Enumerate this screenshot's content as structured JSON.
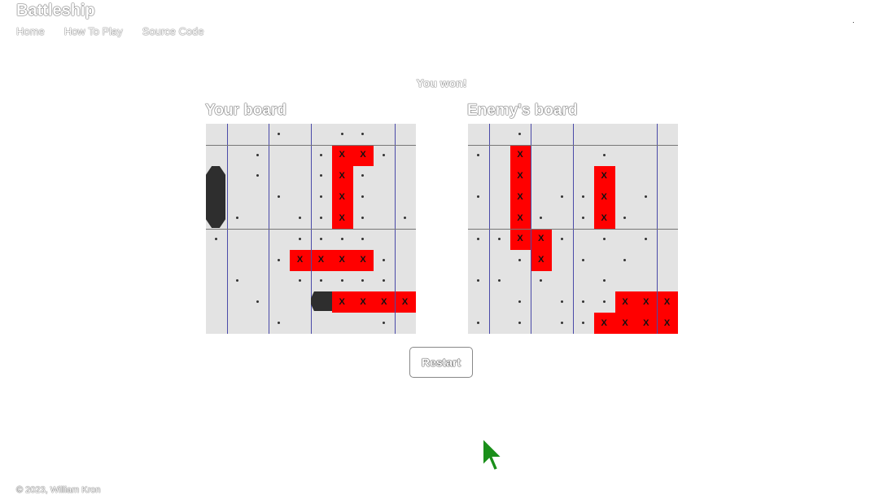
{
  "site": {
    "title": "Battleship"
  },
  "nav": {
    "items": [
      "Home",
      "How To Play",
      "Source Code"
    ]
  },
  "status": "You won!",
  "boards": {
    "player": {
      "title": "Your board",
      "hits": [
        [
          1,
          6
        ],
        [
          1,
          7
        ],
        [
          2,
          6
        ],
        [
          3,
          6
        ],
        [
          4,
          6
        ],
        [
          6,
          4
        ],
        [
          6,
          5
        ],
        [
          6,
          6
        ],
        [
          6,
          7
        ],
        [
          8,
          6
        ],
        [
          8,
          7
        ],
        [
          8,
          8
        ],
        [
          8,
          9
        ]
      ],
      "misses": [
        [
          0,
          3
        ],
        [
          0,
          6
        ],
        [
          0,
          7
        ],
        [
          1,
          2
        ],
        [
          1,
          5
        ],
        [
          1,
          8
        ],
        [
          2,
          2
        ],
        [
          2,
          5
        ],
        [
          2,
          7
        ],
        [
          3,
          3
        ],
        [
          3,
          5
        ],
        [
          3,
          7
        ],
        [
          4,
          1
        ],
        [
          4,
          4
        ],
        [
          4,
          5
        ],
        [
          4,
          7
        ],
        [
          4,
          9
        ],
        [
          5,
          0
        ],
        [
          5,
          4
        ],
        [
          5,
          5
        ],
        [
          5,
          6
        ],
        [
          5,
          7
        ],
        [
          6,
          3
        ],
        [
          6,
          8
        ],
        [
          7,
          1
        ],
        [
          7,
          4
        ],
        [
          7,
          5
        ],
        [
          7,
          6
        ],
        [
          7,
          7
        ],
        [
          7,
          8
        ],
        [
          8,
          2
        ],
        [
          9,
          3
        ],
        [
          9,
          8
        ]
      ]
    },
    "enemy": {
      "title": "Enemy's board",
      "hits": [
        [
          1,
          2
        ],
        [
          2,
          2
        ],
        [
          2,
          6
        ],
        [
          3,
          2
        ],
        [
          3,
          6
        ],
        [
          4,
          2
        ],
        [
          4,
          6
        ],
        [
          5,
          2
        ],
        [
          5,
          3
        ],
        [
          6,
          3
        ],
        [
          8,
          7
        ],
        [
          8,
          8
        ],
        [
          8,
          9
        ],
        [
          9,
          6
        ],
        [
          9,
          7
        ],
        [
          9,
          8
        ],
        [
          9,
          9
        ]
      ],
      "misses": [
        [
          0,
          2
        ],
        [
          1,
          0
        ],
        [
          1,
          6
        ],
        [
          3,
          0
        ],
        [
          3,
          4
        ],
        [
          3,
          5
        ],
        [
          3,
          8
        ],
        [
          4,
          3
        ],
        [
          4,
          5
        ],
        [
          4,
          7
        ],
        [
          5,
          0
        ],
        [
          5,
          1
        ],
        [
          5,
          4
        ],
        [
          5,
          6
        ],
        [
          5,
          8
        ],
        [
          6,
          2
        ],
        [
          6,
          5
        ],
        [
          6,
          7
        ],
        [
          7,
          0
        ],
        [
          7,
          1
        ],
        [
          7,
          3
        ],
        [
          7,
          6
        ],
        [
          8,
          2
        ],
        [
          8,
          4
        ],
        [
          8,
          5
        ],
        [
          8,
          6
        ],
        [
          9,
          0
        ],
        [
          9,
          2
        ],
        [
          9,
          4
        ],
        [
          9,
          5
        ]
      ]
    },
    "hit_mark": "X",
    "hit_color": "#ff0000",
    "water_color": "#e3e3e3",
    "ship_color": "#2e2e2e"
  },
  "buttons": {
    "restart": "Restart"
  },
  "footer": "© 2023, William Kron"
}
